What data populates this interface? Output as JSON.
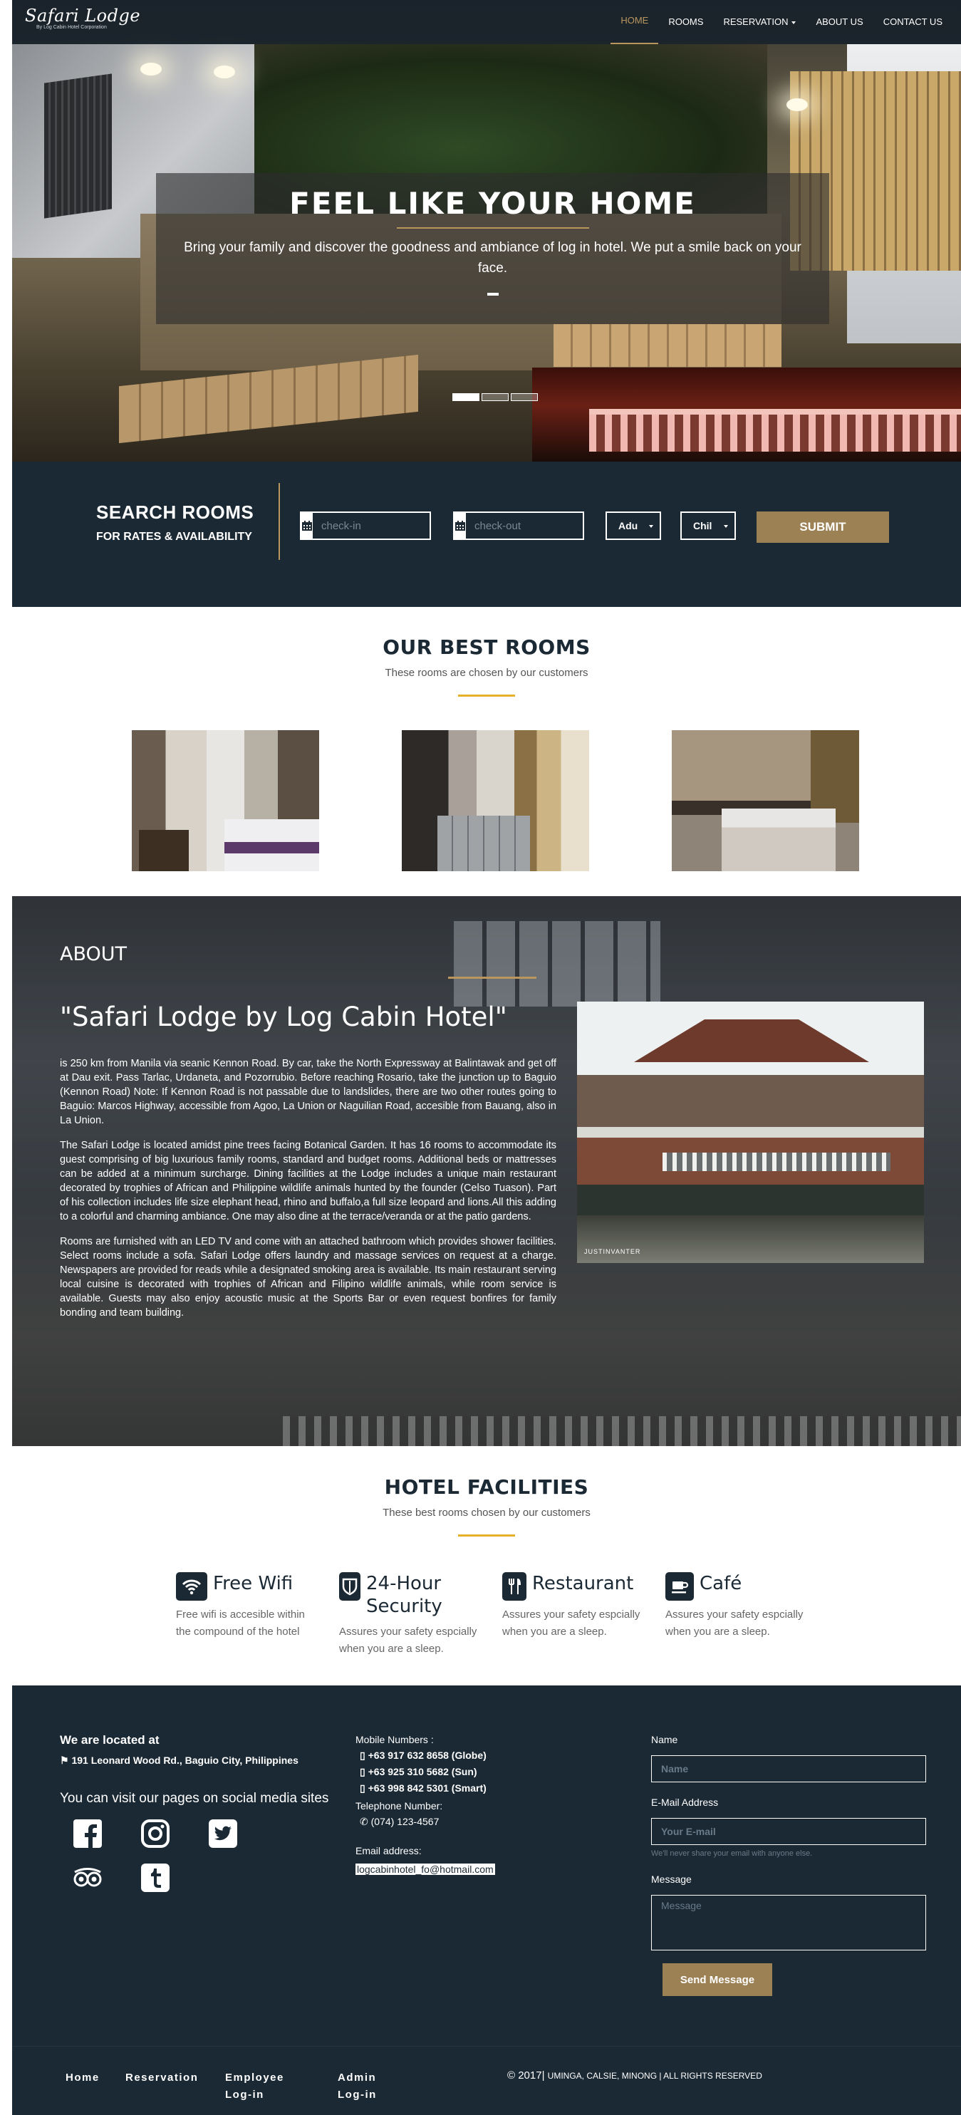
{
  "brand": {
    "logo_text": "Safari Lodge",
    "logo_sub": "By Log Cabin Hotel Corporation"
  },
  "nav": {
    "items": [
      {
        "label": "HOME",
        "active": true
      },
      {
        "label": "ROOMS"
      },
      {
        "label": "RESERVATION",
        "dropdown": true
      },
      {
        "label": "ABOUT US"
      },
      {
        "label": "CONTACT US"
      }
    ],
    "accent": "#b9965e"
  },
  "hero": {
    "title": "FEEL LIKE YOUR HOME",
    "text": "Bring your family and discover the goodness and ambiance of log in hotel. We put a smile back on your face.",
    "slide_count": 3,
    "active_slide": 1
  },
  "search": {
    "title": "SEARCH ROOMS",
    "subtitle": "FOR RATES & AVAILABILITY",
    "checkin_placeholder": "check-in",
    "checkout_placeholder": "check-out",
    "adults": "Adu",
    "children": "Chil",
    "submit": "SUBMIT"
  },
  "rooms": {
    "title": "OUR BEST ROOMS",
    "subtitle": "These rooms are chosen by our customers"
  },
  "about": {
    "heading": "ABOUT",
    "subheading": "\"Safari Lodge by Log Cabin Hotel\"",
    "paragraphs": [
      "is 250 km from Manila via seanic Kennon Road. By car, take the North Expressway at Balintawak and get off at Dau exit. Pass Tarlac, Urdaneta, and Pozorrubio. Before reaching Rosario, take the junction up to Baguio (Kennon Road) Note: If Kennon Road is not passable due to landslides, there are two other routes going to Baguio: Marcos Highway, accessible from Agoo, La Union or Naguilian Road, accesible from Bauang, also in La Union.",
      "The Safari Lodge is located amidst pine trees facing Botanical Garden. It has 16 rooms to accommodate its guest comprising of big luxurious family rooms, standard and budget rooms. Additional beds or mattresses can be added at a minimum surcharge. Dining facilities at the Lodge includes a unique main restaurant decorated by trophies of African and Philippine wildlife animals hunted by the founder (Celso Tuason). Part of his collection includes life size elephant head, rhino and buffalo,a full size leopard and lions.All this adding to a colorful and charming ambiance. One may also dine at the terrace/veranda or at the patio gardens.",
      "Rooms are furnished with an LED TV and come with an attached bathroom which provides shower facilities. Select rooms include a sofa. Safari Lodge offers laundry and massage services on request at a charge. Newspapers are provided for reads while a designated smoking area is available. Its main restaurant serving local cuisine is decorated with trophies of African and Filipino wildlife animals, while room service is available. Guests may also enjoy acoustic music at the Sports Bar or even request bonfires for family bonding and team building."
    ],
    "photo_watermark": "JUSTINVANTER"
  },
  "facilities": {
    "title": "HOTEL FACILITIES",
    "subtitle": "These best rooms chosen by our customers",
    "items": [
      {
        "icon": "wifi-icon",
        "name": "Free Wifi",
        "desc": "Free wifi is accesible within the compound of the hotel"
      },
      {
        "icon": "shield-icon",
        "name": "24-Hour Security",
        "desc": "Assures your safety espcially when you are a sleep."
      },
      {
        "icon": "cutlery-icon",
        "name": "Restaurant",
        "desc": "Assures your safety espcially when you are a sleep."
      },
      {
        "icon": "coffee-cup-icon",
        "name": "Café",
        "desc": "Assures your safety espcially when you are a sleep."
      }
    ]
  },
  "footer": {
    "located_title": "We are located at",
    "address": "191 Leonard Wood Rd., Baguio City, Philippines",
    "social_title": "You can visit our pages on social media sites",
    "socials": [
      "facebook-icon",
      "instagram-icon",
      "twitter-icon",
      "tripadvisor-icon",
      "tumblr-icon"
    ],
    "mobile_label": "Mobile Numbers :",
    "mobiles": [
      "+63 917 632 8658 (Globe)",
      "+63 925 310 5682 (Sun)",
      "+63 998 842 5301 (Smart)"
    ],
    "telephone_label": "Telephone Number:",
    "telephone": "(074) 123-4567",
    "email_label": "Email address:",
    "email": "logcabinhotel_fo@hotmail.com",
    "form": {
      "name_label": "Name",
      "name_placeholder": "Name",
      "email_label": "E-Mail Address",
      "email_placeholder": "Your E-mail",
      "email_hint": "We'll never share your email with anyone else.",
      "message_label": "Message",
      "message_placeholder": "Message",
      "send": "Send Message"
    }
  },
  "bottom": {
    "links": [
      "Home",
      "Reservation",
      "Employee Log-in",
      "Admin Log-in"
    ],
    "copyright": "© 2017|",
    "copyright_small": "UMINGA, CALSIE, MINONG | ALL RIGHTS RESERVED"
  }
}
